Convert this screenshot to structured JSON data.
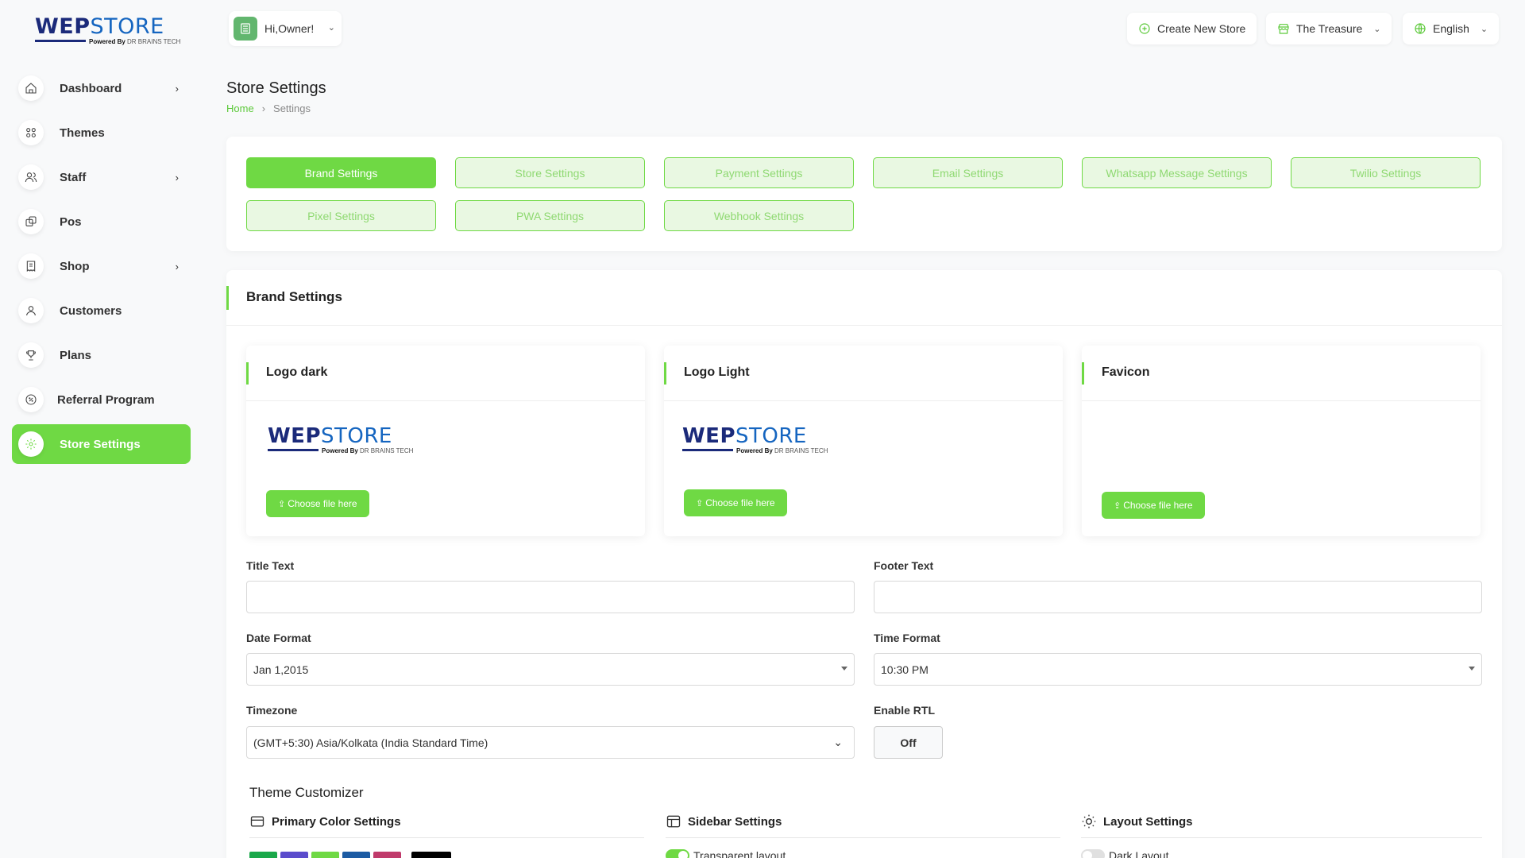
{
  "brand": {
    "logo_part1": "WEP",
    "logo_part2": "STORE",
    "logo_powered": "Powered By",
    "logo_company": "DR BRAINS TECH"
  },
  "sidebar": {
    "items": [
      {
        "label": "Dashboard",
        "icon": "home-icon",
        "has_chevron": true
      },
      {
        "label": "Themes",
        "icon": "grid-icon",
        "has_chevron": false
      },
      {
        "label": "Staff",
        "icon": "users-icon",
        "has_chevron": true
      },
      {
        "label": "Pos",
        "icon": "layers-icon",
        "has_chevron": false
      },
      {
        "label": "Shop",
        "icon": "receipt-icon",
        "has_chevron": true
      },
      {
        "label": "Customers",
        "icon": "user-icon",
        "has_chevron": false
      },
      {
        "label": "Plans",
        "icon": "trophy-icon",
        "has_chevron": false
      },
      {
        "label": "Referral Program",
        "icon": "discount-icon",
        "has_chevron": false
      },
      {
        "label": "Store Settings",
        "icon": "gear-icon",
        "has_chevron": false,
        "active": true
      }
    ]
  },
  "header": {
    "user_greeting": "Hi,Owner!",
    "create_store": "Create New Store",
    "store_name": "The Treasure",
    "language": "English"
  },
  "page": {
    "title": "Store Settings",
    "breadcrumb_home": "Home",
    "breadcrumb_current": "Settings"
  },
  "tabs": [
    "Brand Settings",
    "Store Settings",
    "Payment Settings",
    "Email Settings",
    "Whatsapp Message Settings",
    "Twilio Settings",
    "Pixel Settings",
    "PWA Settings",
    "Webhook Settings"
  ],
  "brand_settings": {
    "title": "Brand Settings",
    "logo_dark": "Logo dark",
    "logo_light": "Logo Light",
    "favicon": "Favicon",
    "choose_file": "Choose file here",
    "title_text_label": "Title Text",
    "title_text_value": "",
    "footer_text_label": "Footer Text",
    "footer_text_value": "",
    "date_format_label": "Date Format",
    "date_format_value": "Jan 1,2015",
    "time_format_label": "Time Format",
    "time_format_value": "10:30 PM",
    "timezone_label": "Timezone",
    "timezone_value": "(GMT+5:30) Asia/Kolkata (India Standard Time)",
    "rtl_label": "Enable RTL",
    "rtl_value": "Off"
  },
  "theme_customizer": {
    "title": "Theme Customizer",
    "primary_color": "Primary Color Settings",
    "sidebar": "Sidebar Settings",
    "layout": "Layout Settings",
    "transparent_layout": "Transparent layout",
    "transparent_on": true,
    "dark_layout": "Dark Layout",
    "dark_on": false,
    "swatch_colors": [
      "#1aa84a",
      "#5b4ccc",
      "#6fd944",
      "#1c5ba3",
      "#c03a6b",
      "#000000"
    ]
  },
  "colors": {
    "accent": "#6fd944",
    "accent_light": "#e9f8e2"
  }
}
